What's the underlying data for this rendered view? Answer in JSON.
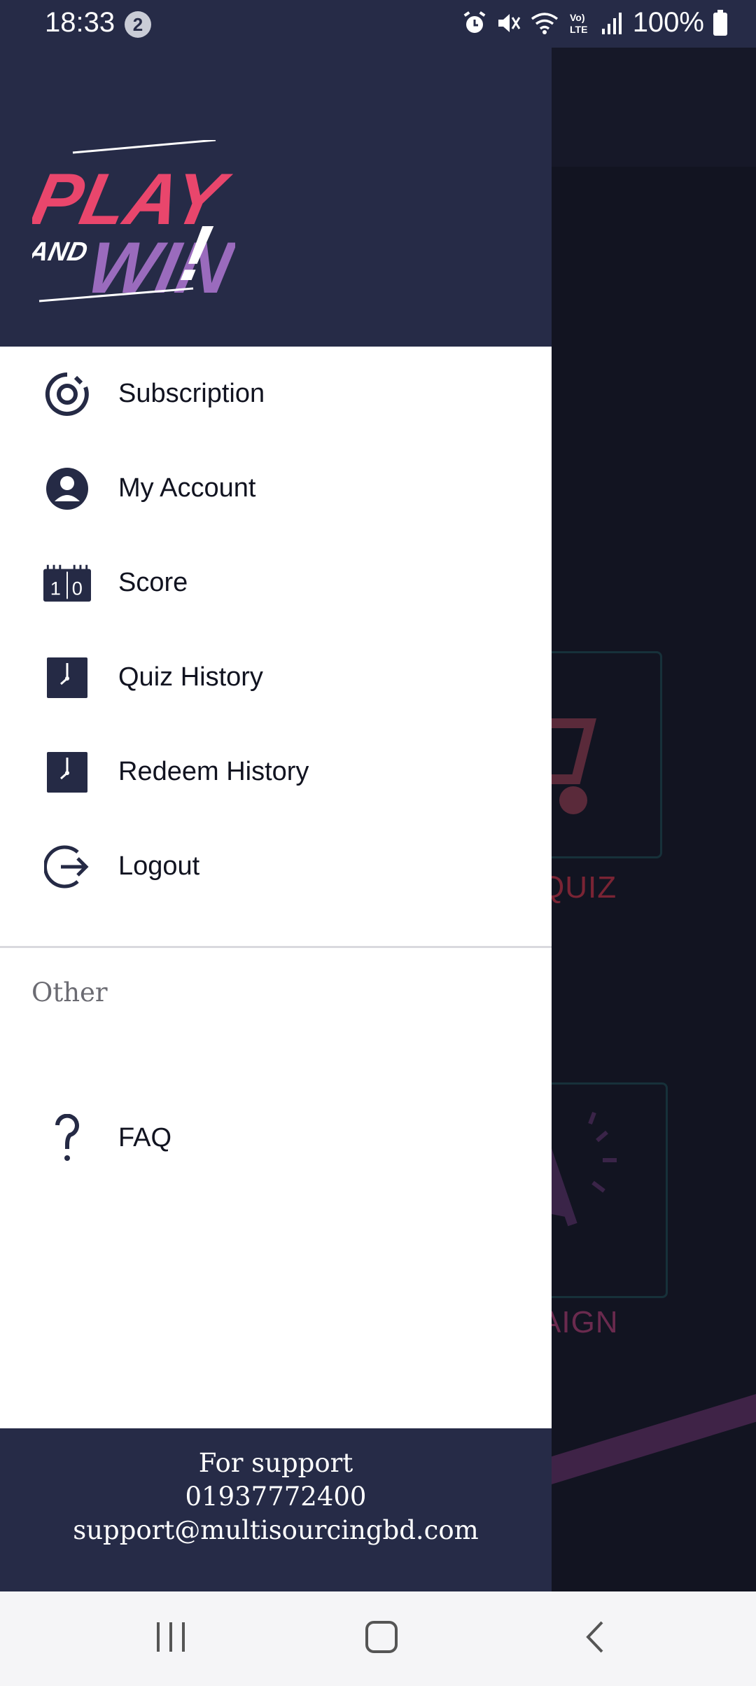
{
  "status_bar": {
    "time": "18:33",
    "notification_count": "2",
    "battery": "100%",
    "network_label": "Vo) LTE"
  },
  "drawer": {
    "logo": {
      "line1": "PLAY",
      "line2_small": "AND",
      "line2": "WIN",
      "mark": "!"
    },
    "menu_items": [
      {
        "label": "Subscription",
        "icon": "subscription-icon"
      },
      {
        "label": "My Account",
        "icon": "account-icon"
      },
      {
        "label": "Score",
        "icon": "score-icon"
      },
      {
        "label": "Quiz History",
        "icon": "clock-icon"
      },
      {
        "label": "Redeem History",
        "icon": "clock-icon"
      },
      {
        "label": "Logout",
        "icon": "logout-icon"
      }
    ],
    "section_other": "Other",
    "faq_label": "FAQ",
    "score_icon_digits": [
      "1",
      "0"
    ],
    "footer": {
      "title": "For support",
      "phone": "01937772400",
      "email": "support@multisourcingbd.com"
    }
  },
  "background": {
    "card1_label": "QUIZ",
    "card2_label": "AIGN"
  },
  "colors": {
    "drawer_dark": "#262b47",
    "logo_pink": "#e9466c",
    "logo_purple": "#9a6bbd",
    "icon_navy": "#252a45"
  }
}
